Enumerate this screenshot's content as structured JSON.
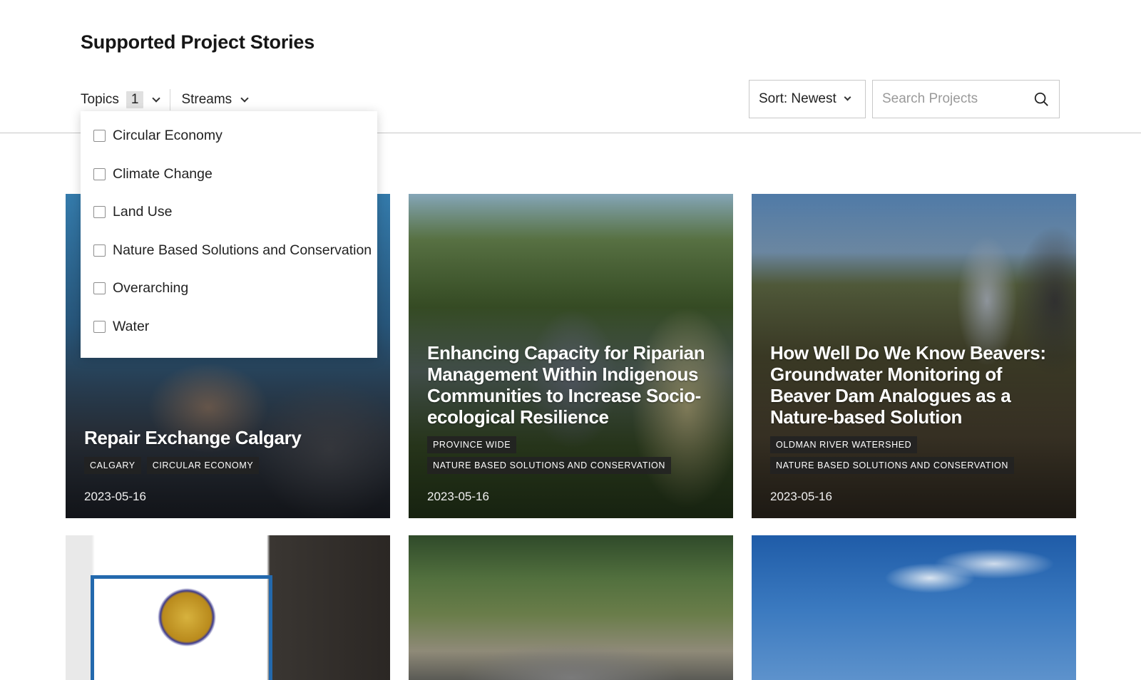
{
  "page": {
    "title": "Supported Project Stories"
  },
  "filters": {
    "topics_label": "Topics",
    "topics_count": "1",
    "streams_label": "Streams",
    "sort_label": "Sort: Newest",
    "search_placeholder": "Search Projects"
  },
  "topics_dropdown": {
    "options": [
      "Circular Economy",
      "Climate Change",
      "Land Use",
      "Nature Based Solutions and Conservation",
      "Overarching",
      "Water"
    ]
  },
  "cards": [
    {
      "title": "Repair Exchange Calgary",
      "tags": [
        "CALGARY",
        "CIRCULAR ECONOMY"
      ],
      "date": "2023-05-16"
    },
    {
      "title": "Enhancing Capacity for Riparian Management Within Indigenous Communities to Increase Socio-ecological Resilience",
      "tags": [
        "PROVINCE WIDE",
        "NATURE BASED SOLUTIONS AND CONSERVATION"
      ],
      "date": "2023-05-16"
    },
    {
      "title": "How Well Do We Know Beavers: Groundwater Monitoring of Beaver Dam Analogues as a Nature-based Solution",
      "tags": [
        "OLDMAN RIVER WATERSHED",
        "NATURE BASED SOLUTIONS AND CONSERVATION"
      ],
      "date": "2023-05-16"
    }
  ],
  "colors": {
    "text": "#161616",
    "tag_bg": "#222222",
    "border": "#c8c8c8",
    "count_bg": "#e0e0e0"
  },
  "icons": {
    "search": "search-icon",
    "dropdown": "chevron-down-icon",
    "checkbox": "checkbox-icon"
  }
}
